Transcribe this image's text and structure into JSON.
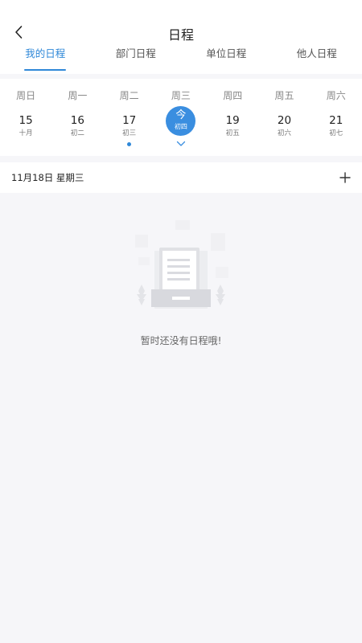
{
  "header": {
    "title": "日程"
  },
  "tabs": [
    {
      "label": "我的日程",
      "active": true
    },
    {
      "label": "部门日程",
      "active": false
    },
    {
      "label": "单位日程",
      "active": false
    },
    {
      "label": "他人日程",
      "active": false
    }
  ],
  "week": {
    "weekdays": [
      "周日",
      "周一",
      "周二",
      "周三",
      "周四",
      "周五",
      "周六"
    ],
    "days": [
      {
        "day": "15",
        "lunar": "十月",
        "has_event": false
      },
      {
        "day": "16",
        "lunar": "初二",
        "has_event": false
      },
      {
        "day": "17",
        "lunar": "初三",
        "has_event": true
      },
      {
        "day": "今",
        "lunar": "初四",
        "has_event": false,
        "today": true
      },
      {
        "day": "19",
        "lunar": "初五",
        "has_event": false
      },
      {
        "day": "20",
        "lunar": "初六",
        "has_event": false
      },
      {
        "day": "21",
        "lunar": "初七",
        "has_event": false
      }
    ]
  },
  "selected_date": {
    "label": "11月18日 星期三"
  },
  "empty_state": {
    "text": "暂时还没有日程哦!"
  },
  "colors": {
    "accent": "#2f88d8",
    "today_bg": "#3a8ee0",
    "page_bg": "#f6f6f9"
  },
  "icons": {
    "back": "chevron-left-icon",
    "expand": "chevron-down-icon",
    "add": "plus-icon",
    "empty": "document-tray-icon"
  }
}
